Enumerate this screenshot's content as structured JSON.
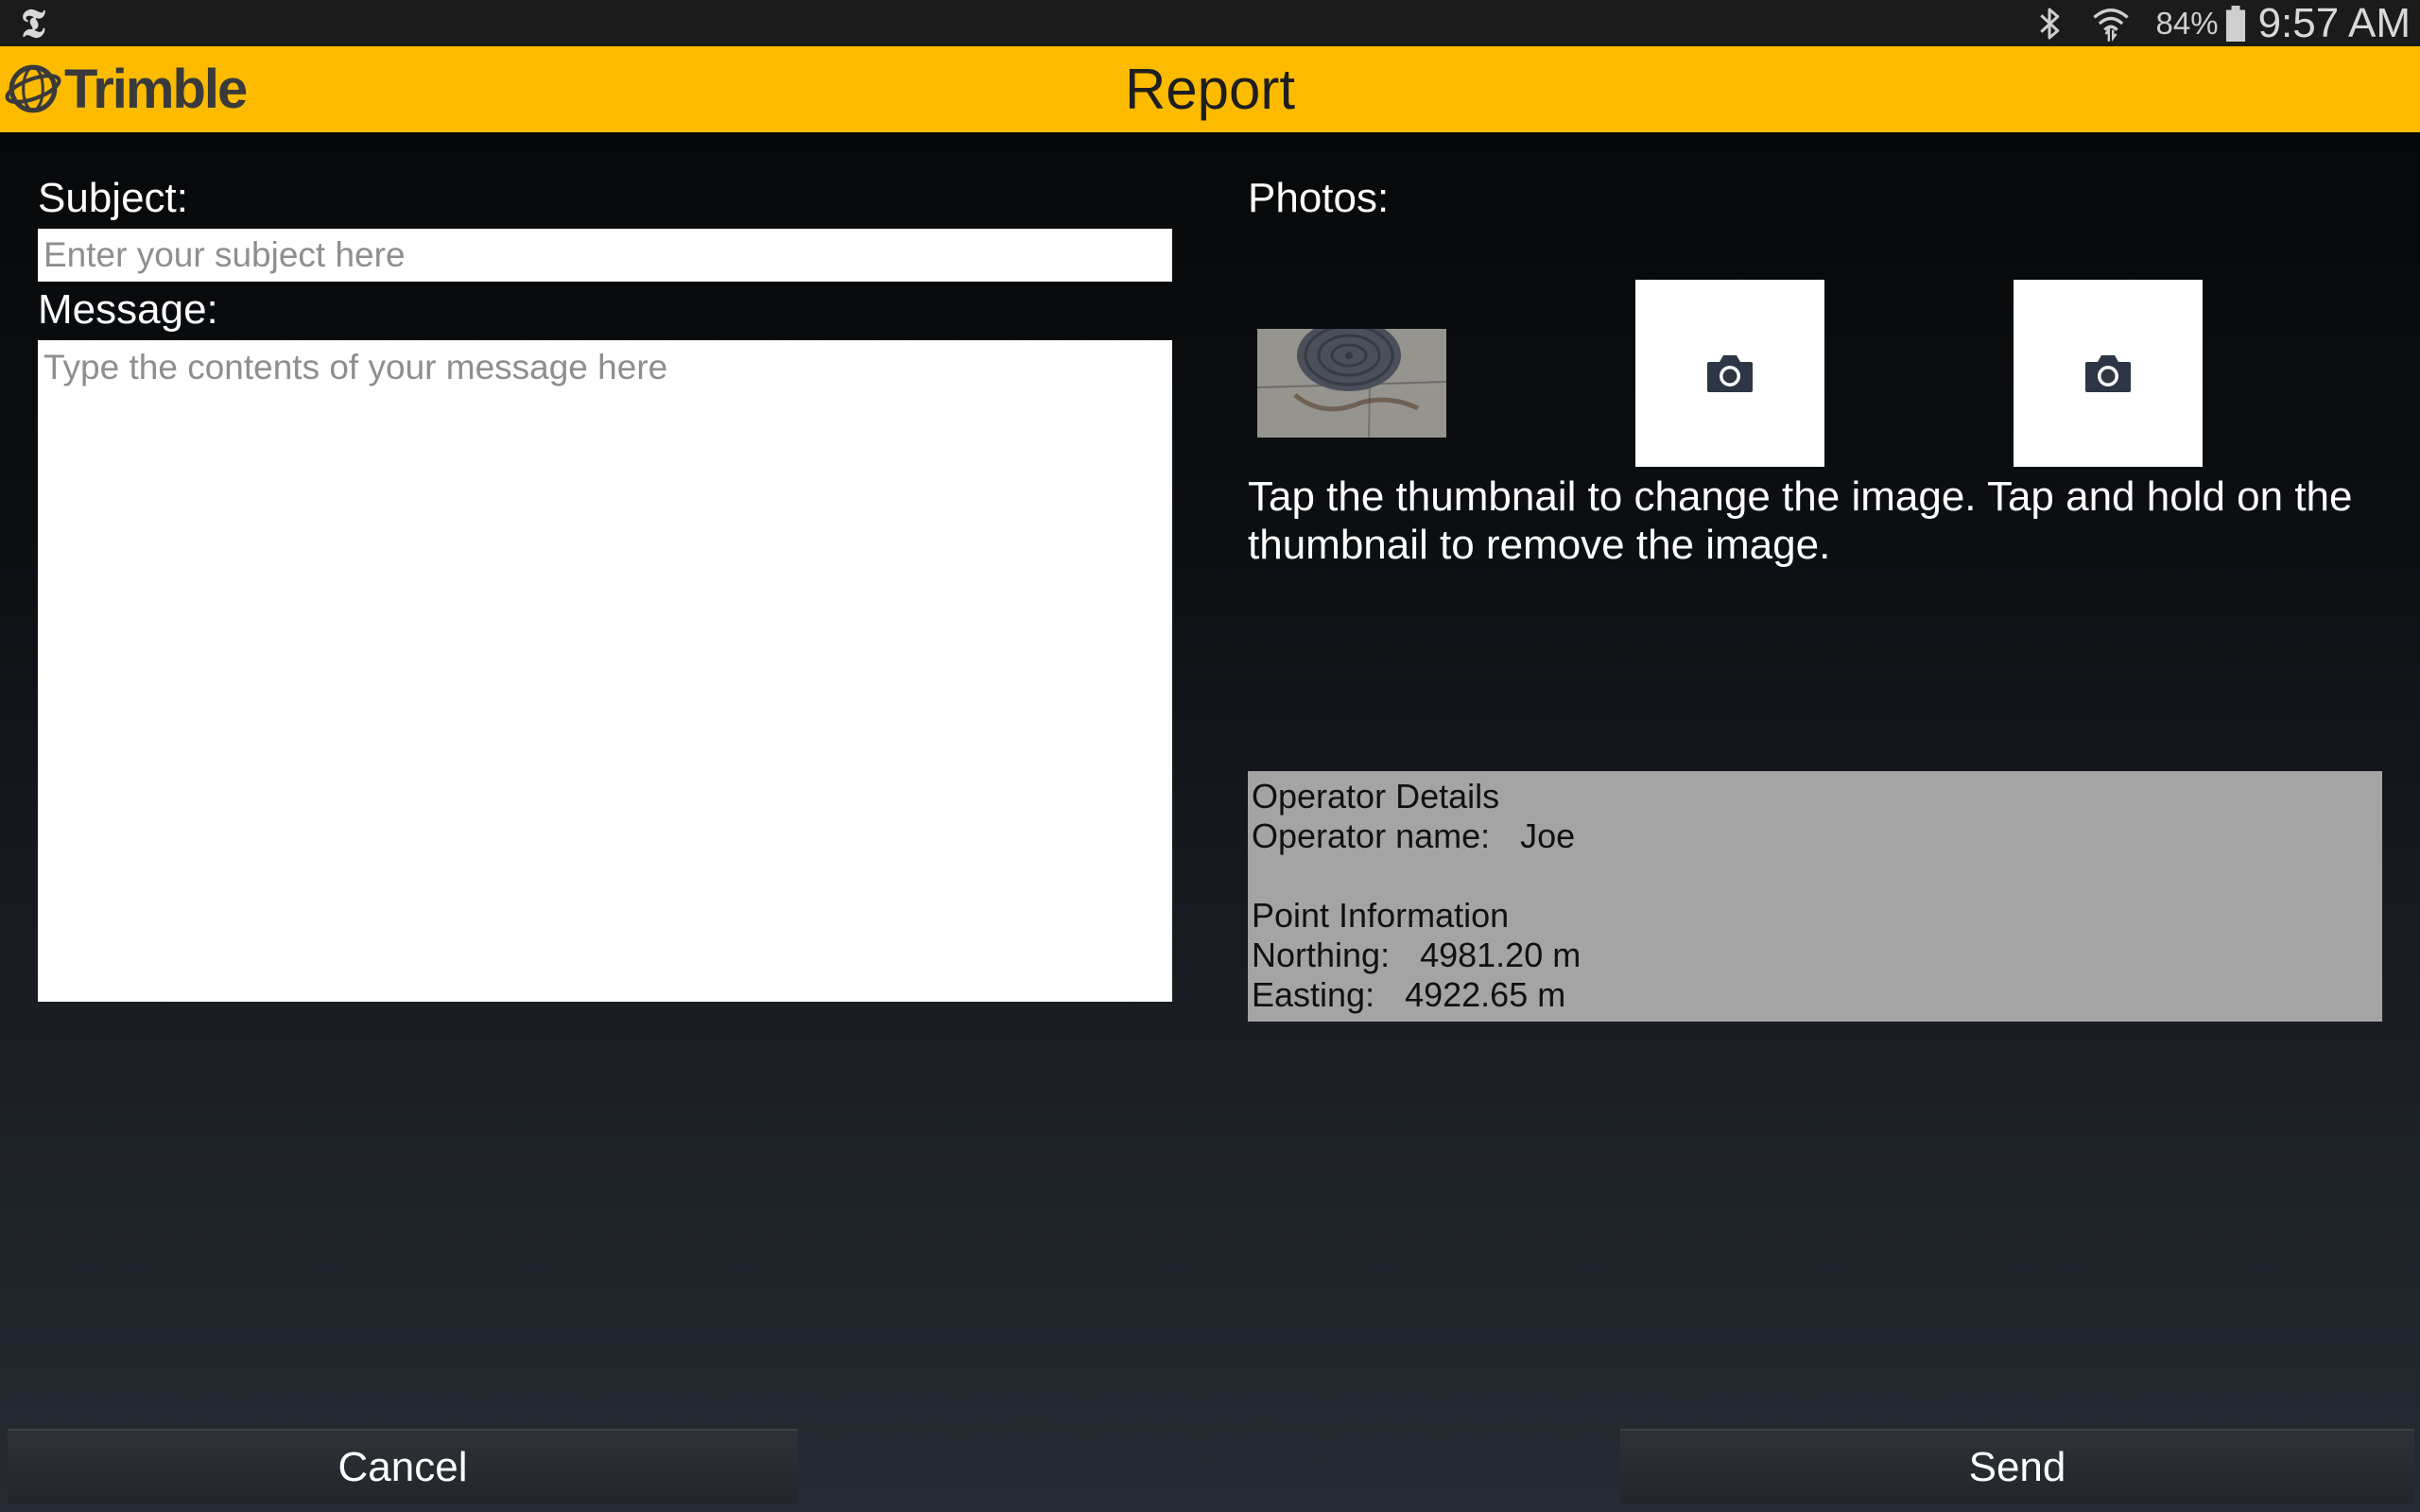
{
  "status_bar": {
    "app_icon": "nyt-icon",
    "bluetooth_icon": "bluetooth-icon",
    "wifi_icon": "wifi-icon",
    "battery_percent": "84%",
    "time": "9:57 AM"
  },
  "header": {
    "logo_text": "Trimble",
    "logo_icon": "trimble-globe-icon",
    "title": "Report",
    "background_color": "#fdbb00"
  },
  "form": {
    "subject_label": "Subject:",
    "subject_value": "",
    "subject_placeholder": "Enter your subject here",
    "message_label": "Message:",
    "message_value": "",
    "message_placeholder": "Type the contents of your message here"
  },
  "photos": {
    "label": "Photos:",
    "slots": [
      {
        "kind": "thumbnail",
        "icon": "photo-thumbnail"
      },
      {
        "kind": "empty",
        "icon": "camera-icon"
      },
      {
        "kind": "empty",
        "icon": "camera-icon"
      }
    ],
    "hint": "Tap the thumbnail to change the image. Tap and hold on the thumbnail to remove the image."
  },
  "details": {
    "operator_heading": "Operator Details",
    "operator_name_label": "Operator name:",
    "operator_name_value": "Joe",
    "point_heading": "Point Information",
    "northing_label": "Northing:",
    "northing_value": "4981.20 m",
    "easting_label": "Easting:",
    "easting_value": "4922.65 m"
  },
  "buttons": {
    "cancel_label": "Cancel",
    "send_label": "Send"
  }
}
